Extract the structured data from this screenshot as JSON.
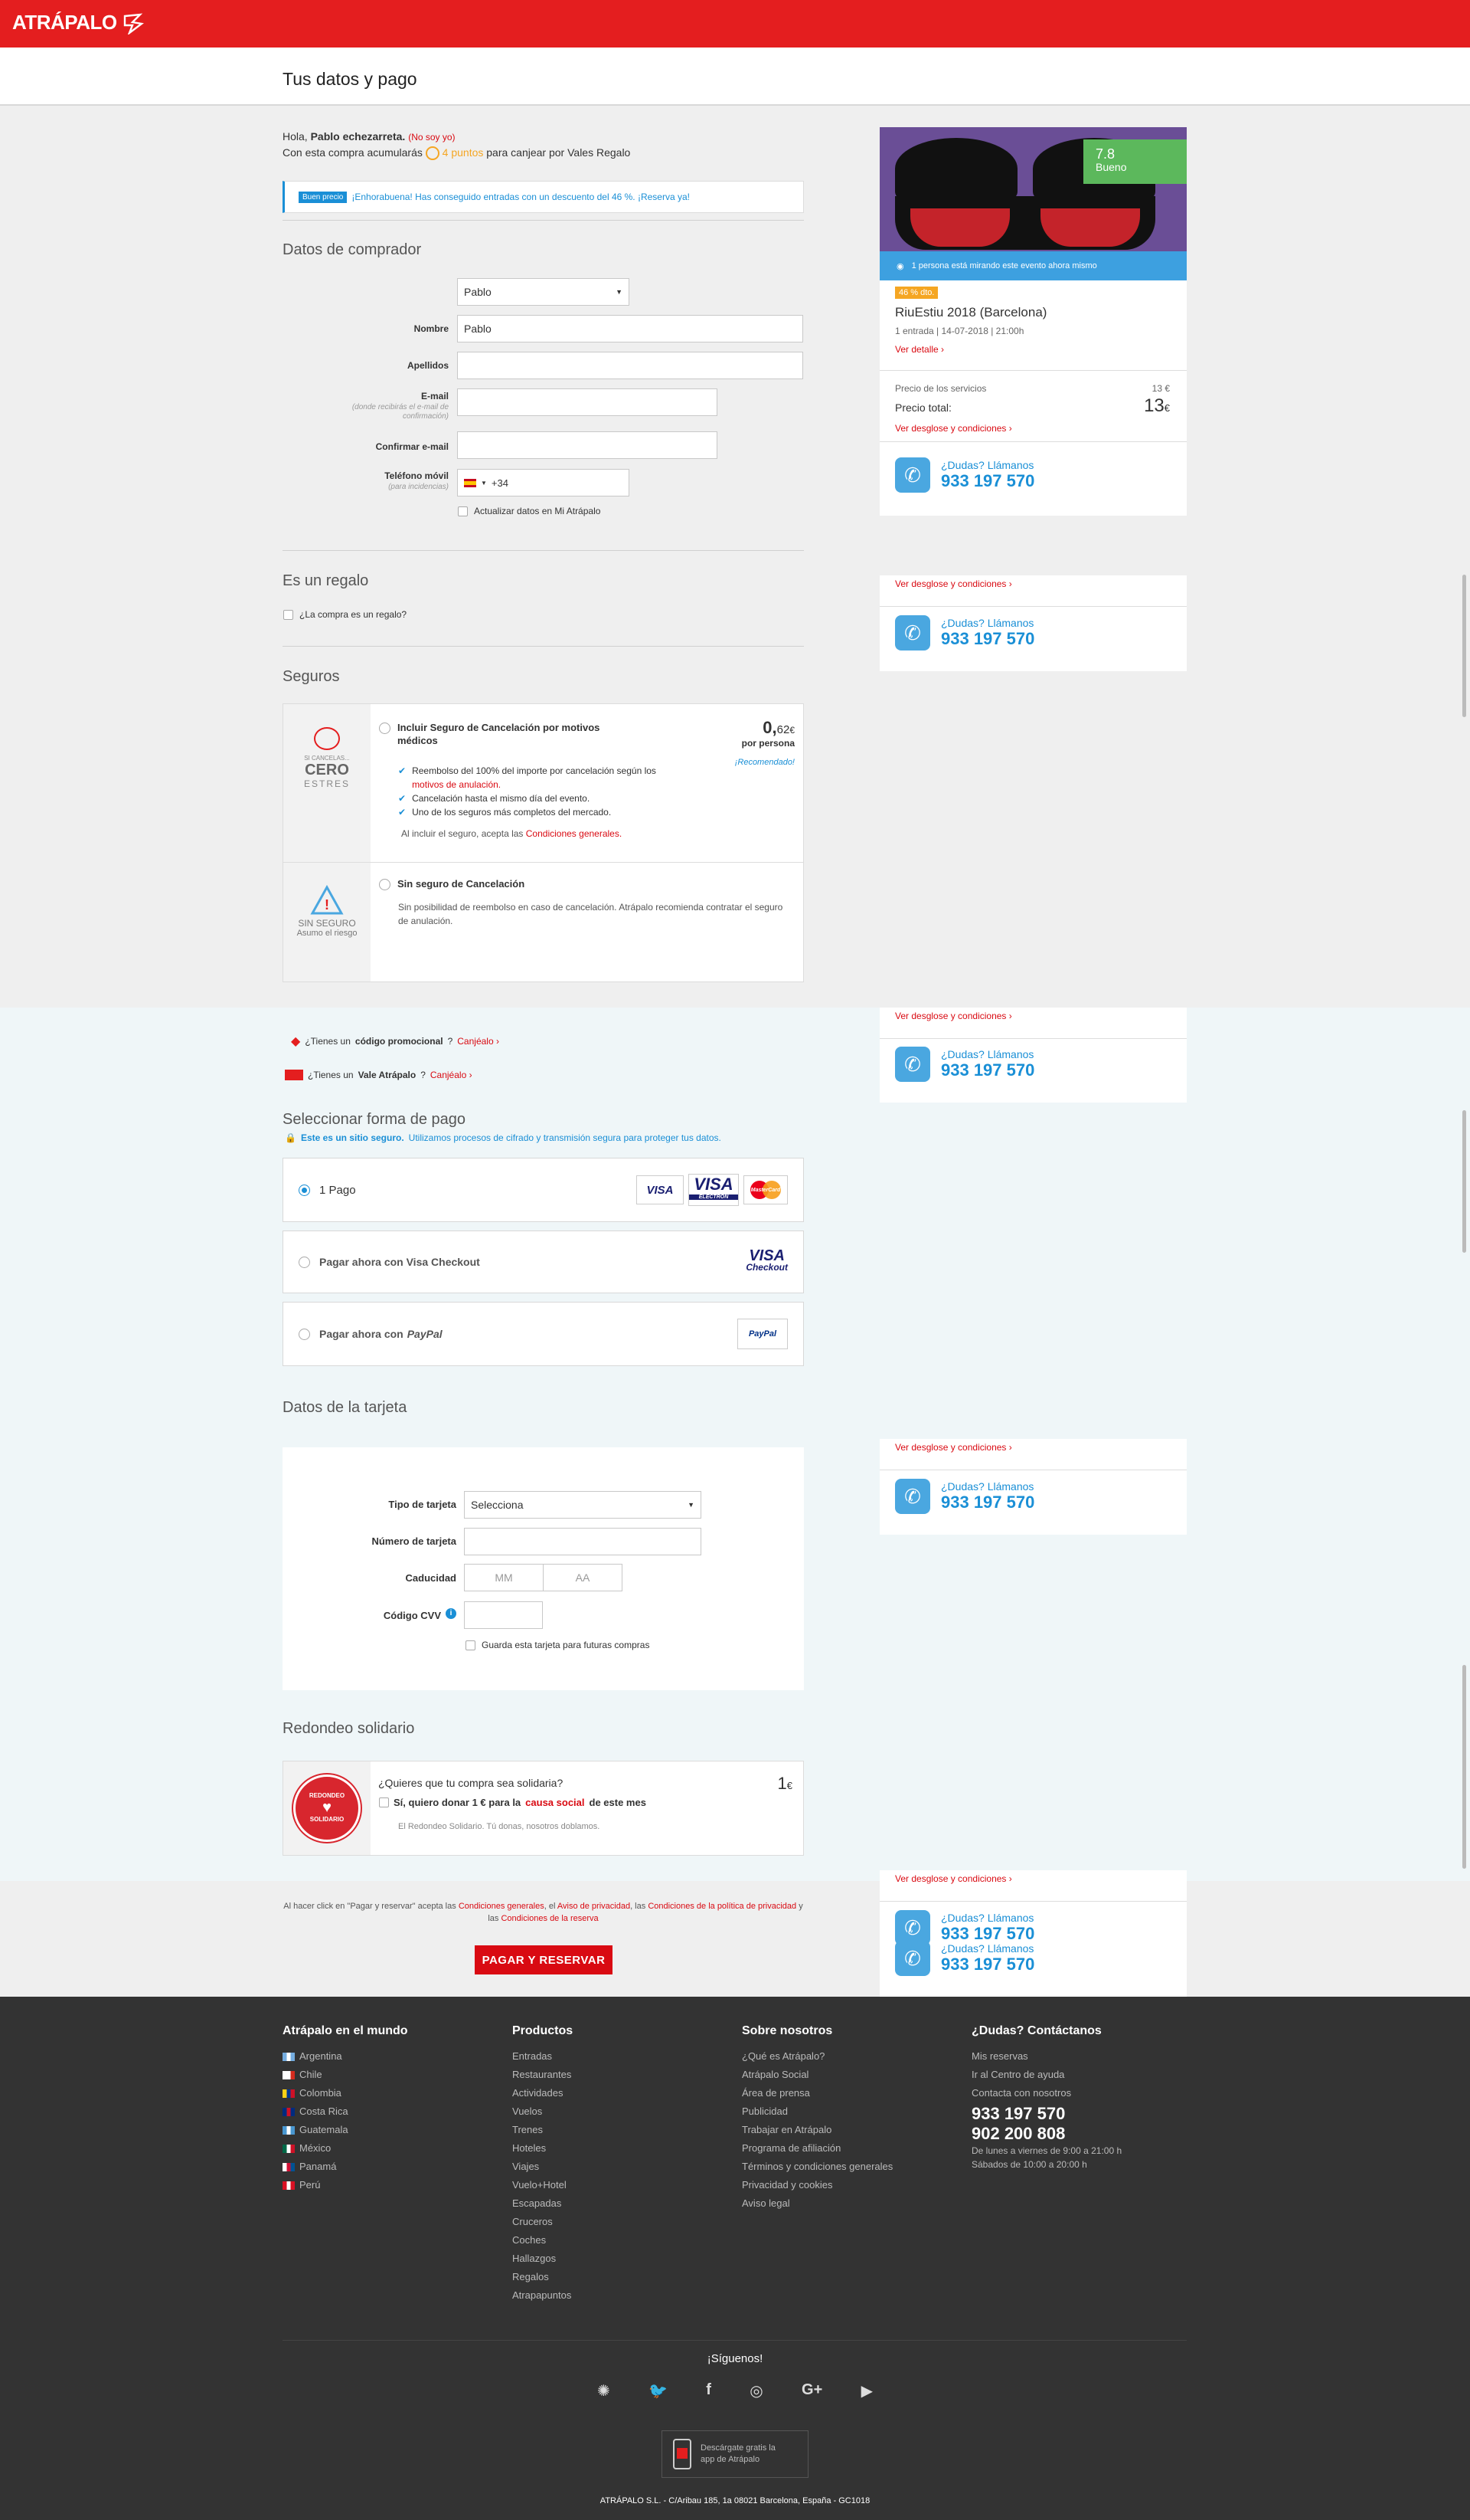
{
  "brand": {
    "logo": "ATRÁPALO",
    "accent": "#e41e1f"
  },
  "page": {
    "title": "Tus datos y pago"
  },
  "greeting": {
    "hello": "Hola,",
    "name": "Pablo echezarreta.",
    "not_you": "(No soy yo)",
    "line2_a": "Con esta compra acumularás",
    "points": "4 puntos",
    "line2_b": "para canjear por Vales Regalo"
  },
  "promo_banner": {
    "badge": "Buen precio",
    "text": "¡Enhorabuena! Has conseguido entradas con un descuento del 46 %. ¡Reserva ya!"
  },
  "buyer": {
    "title": "Datos de comprador",
    "title_select": "Pablo",
    "nombre_label": "Nombre",
    "nombre_value": "Pablo",
    "apellidos_label": "Apellidos",
    "email_label": "E-mail",
    "email_sub": "(donde recibirás el e-mail de confirmación)",
    "confirm_label": "Confirmar e-mail",
    "phone_label": "Teléfono móvil",
    "phone_sub": "(para incidencias)",
    "phone_prefix": "+34",
    "update_label": "Actualizar datos en Mi Atrápalo"
  },
  "gift": {
    "title": "Es un regalo",
    "question": "¿La compra es un regalo?"
  },
  "insurance": {
    "title": "Seguros",
    "opt1_logo_top": "SI CANCELAS...",
    "opt1_logo_big": "CERO",
    "opt1_logo_bottom": "ESTRES",
    "opt1_title": "Incluir Seguro de Cancelación por motivos médicos",
    "opt1_price_int": "0,",
    "opt1_price_dec": "62",
    "opt1_price_cur": "€",
    "opt1_per": "por persona",
    "opt1_recommended": "¡Recomendado!",
    "opt1_b1a": "Reembolso del 100% del importe por cancelación según los",
    "opt1_b1_link": "motivos de anulación.",
    "opt1_b2": "Cancelación hasta el mismo día del evento.",
    "opt1_b3": "Uno de los seguros más completos del mercado.",
    "opt1_accept": "Al incluir el seguro, acepta las",
    "opt1_accept_link": "Condiciones generales.",
    "opt2_logo_a": "SIN SEGURO",
    "opt2_logo_b": "Asumo el riesgo",
    "opt2_title": "Sin seguro de Cancelación",
    "opt2_desc": "Sin posibilidad de reembolso en caso de cancelación. Atrápalo recomienda contratar el seguro de anulación."
  },
  "codes": {
    "promo_a": "¿Tienes un",
    "promo_b": "código promocional",
    "promo_c": "?",
    "promo_link": "Canjéalo ›",
    "vale_a": "¿Tienes un",
    "vale_b": "Vale Atrápalo",
    "vale_c": "?",
    "vale_link": "Canjéalo ›"
  },
  "payment": {
    "title": "Seleccionar forma de pago",
    "secure_a": "Este es un sitio seguro.",
    "secure_b": "Utilizamos procesos de cifrado y transmisión segura para proteger tus datos.",
    "opt1": "1 Pago",
    "opt2": "Pagar ahora con Visa Checkout",
    "opt3_a": "Pagar ahora con",
    "opt3_b": "PayPal",
    "visa": "VISA",
    "visa_electron": "VISA",
    "electron": "ELECTRON",
    "mastercard": "MasterCard",
    "visa_checkout_a": "VISA",
    "visa_checkout_b": "Checkout",
    "paypal": "PayPal"
  },
  "card": {
    "title": "Datos de la tarjeta",
    "type_label": "Tipo de tarjeta",
    "type_value": "Selecciona",
    "number_label": "Número de tarjeta",
    "exp_label": "Caducidad",
    "mm": "MM",
    "aa": "AA",
    "cvv_label": "Código CVV",
    "save": "Guarda esta tarjeta para futuras compras"
  },
  "solidario": {
    "title": "Redondeo solidario",
    "logo_a": "REDONDEO",
    "logo_b": "SOLIDARIO",
    "question": "¿Quieres que tu compra sea solidaria?",
    "amount": "1",
    "cur": "€",
    "opt_a": "Sí, quiero donar 1 € para la",
    "opt_link": "causa social",
    "opt_b": "de este mes",
    "note": "El Redondeo Solidario. Tú donas, nosotros doblamos."
  },
  "legal": {
    "a": "Al hacer click en \"Pagar y reservar\" acepta las",
    "l1": "Condiciones generales",
    "b": ", el",
    "l2": "Aviso de privacidad",
    "c": ", las",
    "l3": "Condiciones de la política de privacidad",
    "d": "y las",
    "l4": "Condiciones de la reserva",
    "button": "PAGAR Y RESERVAR"
  },
  "sidebar": {
    "rating": "7.8",
    "rating_label": "Bueno",
    "watching": "1 persona está mirando este evento ahora mismo",
    "discount": "46 % dto.",
    "event": "RiuEstiu 2018 (Barcelona)",
    "details": "1 entrada | 14-07-2018 | 21:00h",
    "see_detail": "Ver detalle ›",
    "services_label": "Precio de los servicios",
    "services_value": "13 €",
    "total_label": "Precio total:",
    "total_int": "13",
    "total_cur": "€",
    "breakdown": "Ver desglose y condiciones ›",
    "doubts": "¿Dudas? Llámanos",
    "phone": "933 197 570"
  },
  "footer": {
    "world_title": "Atrápalo en el mundo",
    "countries": [
      "Argentina",
      "Chile",
      "Colombia",
      "Costa Rica",
      "Guatemala",
      "México",
      "Panamá",
      "Perú"
    ],
    "products_title": "Productos",
    "products": [
      "Entradas",
      "Restaurantes",
      "Actividades",
      "Vuelos",
      "Trenes",
      "Hoteles",
      "Viajes",
      "Vuelo+Hotel",
      "Escapadas",
      "Cruceros",
      "Coches",
      "Hallazgos",
      "Regalos",
      "Atrapapuntos"
    ],
    "about_title": "Sobre nosotros",
    "about": [
      "¿Qué es Atrápalo?",
      "Atrápalo Social",
      "Área de prensa",
      "Publicidad",
      "Trabajar en Atrápalo",
      "Programa de afiliación",
      "Términos y condiciones generales",
      "Privacidad y cookies",
      "Aviso legal"
    ],
    "help_title": "¿Dudas? Contáctanos",
    "help": [
      "Mis reservas",
      "Ir al Centro de ayuda",
      "Contacta con nosotros"
    ],
    "phone1": "933 197 570",
    "phone2": "902 200 808",
    "hours1": "De lunes a viernes de 9:00 a 21:00 h",
    "hours2": "Sábados de 10:00 a 20:00 h",
    "follow": "¡Síguenos!",
    "app_a": "Descárgate gratis la",
    "app_b": "app de Atrápalo",
    "company": "ATRÁPALO S.L. - C/Aribau 185, 1a 08021 Barcelona, España - GC1018"
  }
}
